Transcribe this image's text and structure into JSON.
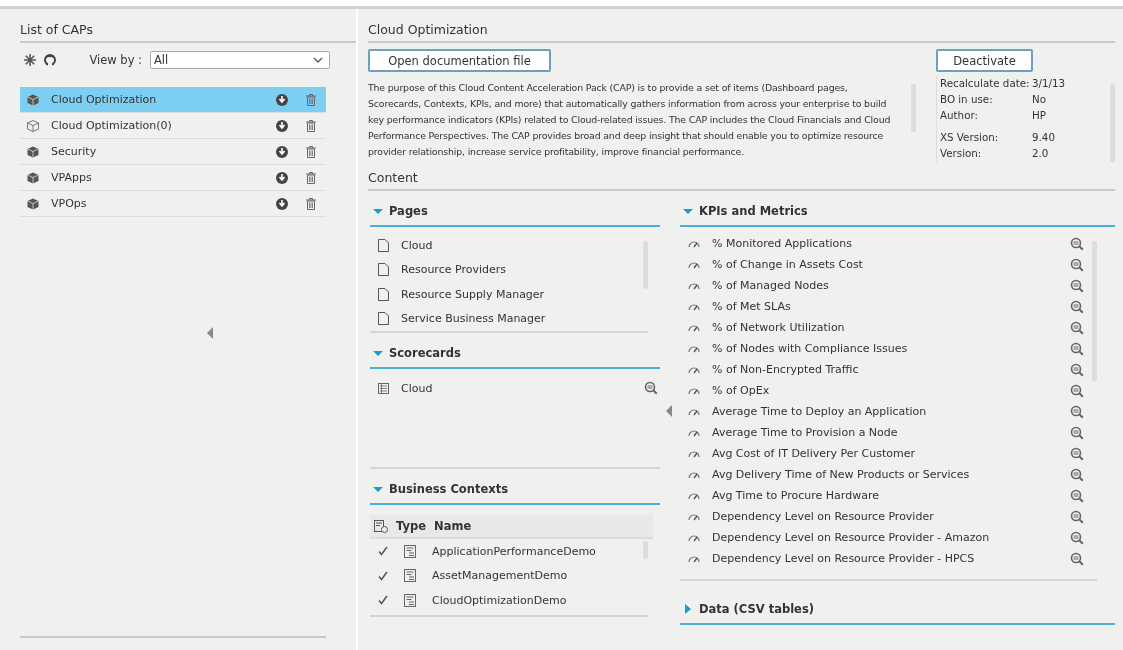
{
  "caps_panel": {
    "title": "List of CAPs",
    "view_by_label": "View by :",
    "view_by_value": "All",
    "items": [
      {
        "name": "Cloud Optimization",
        "selected": true,
        "kind": "installed"
      },
      {
        "name": "Cloud Optimization(0)",
        "selected": false,
        "kind": "outline"
      },
      {
        "name": "Security",
        "selected": false,
        "kind": "installed"
      },
      {
        "name": "VPApps",
        "selected": false,
        "kind": "installed"
      },
      {
        "name": "VPOps",
        "selected": false,
        "kind": "installed"
      }
    ]
  },
  "details": {
    "title": "Cloud Optimization",
    "open_doc_button": "Open documentation file",
    "deactivate_button": "Deactivate",
    "description": "The purpose of this Cloud Content Acceleration Pack (CAP) is to provide a set of items (Dashboard pages, Scorecards, Contexts, KPIs, and more) that automatically gathers information from across your enterprise to build key performance indicators (KPIs) related to Cloud-related issues. The CAP includes the Cloud Financials and Cloud Performance Perspectives. The CAP provides broad and deep insight that should enable you to optimize resource provider relationship, increase service profitability, improve financial performance.",
    "info": [
      {
        "label": "Recalculate date:",
        "value": "3/1/13"
      },
      {
        "label": "BO in use:",
        "value": "No"
      },
      {
        "label": "Author:",
        "value": "HP"
      },
      {
        "label": "XS Version:",
        "value": "9.40"
      },
      {
        "label": "Version:",
        "value": "2.0"
      }
    ]
  },
  "content": {
    "title": "Content",
    "pages": {
      "title": "Pages",
      "expanded": true,
      "items": [
        "Cloud",
        "Resource Providers",
        "Resource Supply Manager",
        "Service Business Manager"
      ]
    },
    "scorecards": {
      "title": "Scorecards",
      "expanded": true,
      "items": [
        "Cloud"
      ]
    },
    "business_contexts": {
      "title": "Business Contexts",
      "expanded": true,
      "columns": [
        "Type",
        "Name"
      ],
      "rows": [
        {
          "name": "ApplicationPerformanceDemo",
          "checked": true
        },
        {
          "name": "AssetManagementDemo",
          "checked": true
        },
        {
          "name": "CloudOptimizationDemo",
          "checked": true
        }
      ]
    },
    "kpis": {
      "title": "KPIs and Metrics",
      "expanded": true,
      "items": [
        "% Monitored Applications",
        "% of Change in Assets Cost",
        "% of Managed Nodes",
        "% of Met SLAs",
        "% of Network Utilization",
        "% of Nodes with Compliance Issues",
        "% of Non-Encrypted Traffic",
        "% of OpEx",
        "Average Time to Deploy an Application",
        "Average Time to Provision a Node",
        "Avg Cost of IT Delivery Per Customer",
        "Avg Delivery Time of New Products or Services",
        "Avg Time to Procure Hardware",
        "Dependency Level on Resource Provider",
        "Dependency Level on Resource Provider - Amazon",
        "Dependency Level on Resource Provider - HPCS"
      ]
    },
    "data_tables": {
      "title": "Data (CSV tables)",
      "expanded": false
    }
  }
}
